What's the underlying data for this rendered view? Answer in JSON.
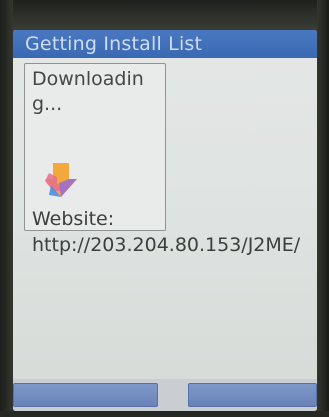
{
  "window": {
    "title": "Getting Install List"
  },
  "status": {
    "message": "Downloading...",
    "icon": "download-arrow-icon",
    "icon_colors": [
      "#f2a83b",
      "#e86f8d",
      "#9a6bd3",
      "#4d8fe0"
    ]
  },
  "website": {
    "label": "Website:",
    "url": "http://203.204.80.153/J2ME/"
  },
  "softkeys": {
    "left_label": "",
    "right_label": ""
  },
  "colors": {
    "title_bar": "#3a69b4",
    "title_text": "#cfdcf1",
    "softkey": "#6983b9",
    "screen_bg": "#dfe3e1"
  }
}
